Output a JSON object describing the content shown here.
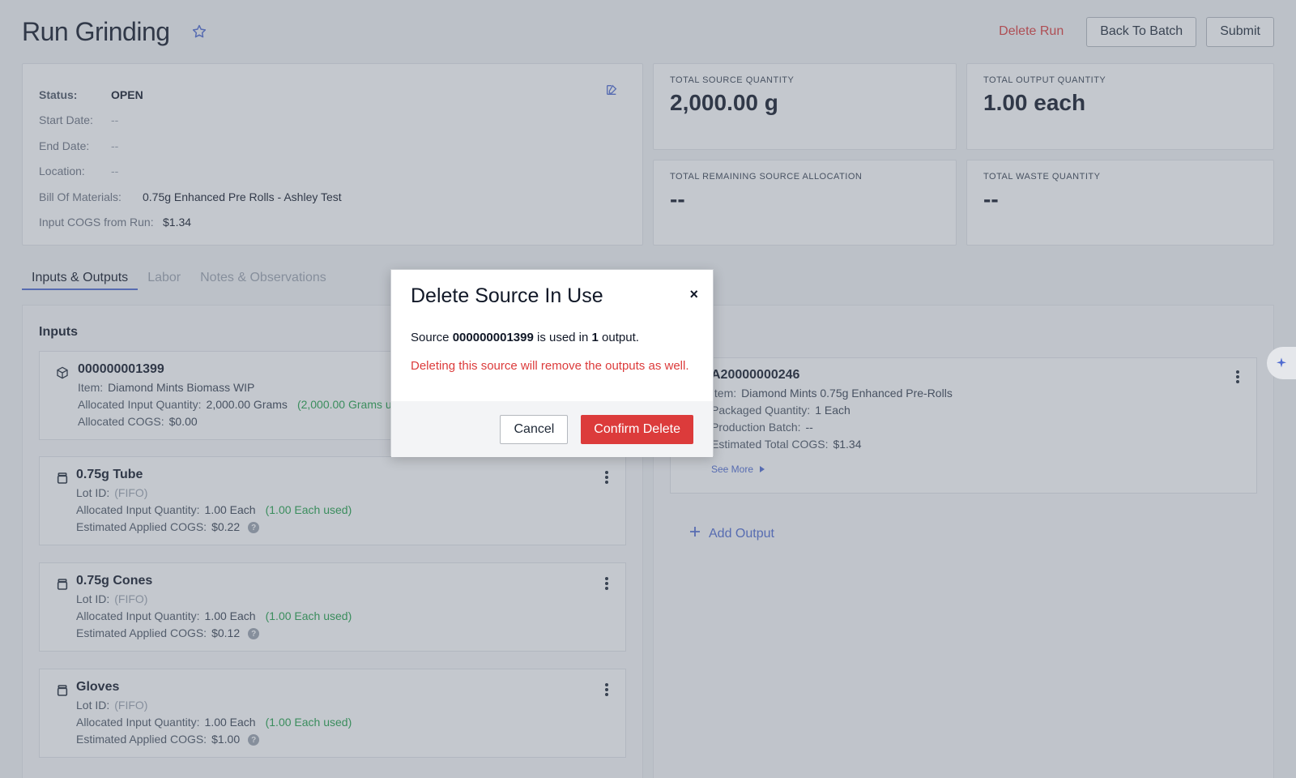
{
  "header": {
    "title": "Run Grinding",
    "delete_run": "Delete Run",
    "back_to_batch": "Back To Batch",
    "submit": "Submit"
  },
  "info": {
    "status_label": "Status:",
    "status_value": "OPEN",
    "start_label": "Start Date:",
    "start_value": "--",
    "end_label": "End Date:",
    "end_value": "--",
    "location_label": "Location:",
    "location_value": "--",
    "bom_label": "Bill Of Materials:",
    "bom_value": "0.75g Enhanced Pre Rolls - Ashley Test",
    "cogs_label": "Input COGS from Run:",
    "cogs_value": "$1.34"
  },
  "stats": {
    "source_label": "TOTAL SOURCE QUANTITY",
    "source_value": "2,000.00 g",
    "output_label": "TOTAL OUTPUT QUANTITY",
    "output_value": "1.00 each",
    "remaining_label": "TOTAL REMAINING SOURCE ALLOCATION",
    "remaining_value": "--",
    "waste_label": "TOTAL WASTE QUANTITY",
    "waste_value": "--"
  },
  "tabs": [
    "Inputs & Outputs",
    "Labor",
    "Notes & Observations"
  ],
  "inputs": {
    "title": "Inputs",
    "items": [
      {
        "title": "000000001399",
        "line1_label": "Item:",
        "line1_value": "Diamond Mints Biomass WIP",
        "line2_label": "Allocated Input Quantity:",
        "line2_value": "2,000.00 Grams",
        "line2_used": "(2,000.00 Grams used)",
        "line3_label": "Allocated COGS:",
        "line3_value": "$0.00"
      },
      {
        "title": "0.75g Tube",
        "line1_label": "Lot ID:",
        "line1_value": "(FIFO)",
        "line2_label": "Allocated Input Quantity:",
        "line2_value": "1.00 Each",
        "line2_used": "(1.00 Each used)",
        "line3_label": "Estimated Applied COGS:",
        "line3_value": "$0.22"
      },
      {
        "title": "0.75g Cones",
        "line1_label": "Lot ID:",
        "line1_value": "(FIFO)",
        "line2_label": "Allocated Input Quantity:",
        "line2_value": "1.00 Each",
        "line2_used": "(1.00 Each used)",
        "line3_label": "Estimated Applied COGS:",
        "line3_value": "$0.12"
      },
      {
        "title": "Gloves",
        "line1_label": "Lot ID:",
        "line1_value": "(FIFO)",
        "line2_label": "Allocated Input Quantity:",
        "line2_value": "1.00 Each",
        "line2_used": "(1.00 Each used)",
        "line3_label": "Estimated Applied COGS:",
        "line3_value": "$1.00"
      }
    ]
  },
  "outputs": {
    "title_fragment": "s",
    "item": {
      "title": "A20000000246",
      "line1_label": "Item:",
      "line1_value": "Diamond Mints 0.75g Enhanced Pre-Rolls",
      "line2_label": "Packaged Quantity:",
      "line2_value": "1 Each",
      "line3_label": "Production Batch:",
      "line3_value": "--",
      "line4_label": "Estimated Total COGS:",
      "line4_value": "$1.34",
      "see_more": "See More"
    },
    "add_output": "Add Output"
  },
  "modal": {
    "title": "Delete Source In Use",
    "close": "×",
    "text_prefix": "Source",
    "source_id": "000000001399",
    "text_middle": "is used in",
    "count": "1",
    "text_suffix": "output.",
    "warning": "Deleting this source will remove the outputs as well.",
    "cancel": "Cancel",
    "confirm": "Confirm Delete"
  },
  "colors": {
    "accent": "#4f6bd1",
    "danger": "#dc3b3b",
    "success": "#22a04a"
  }
}
